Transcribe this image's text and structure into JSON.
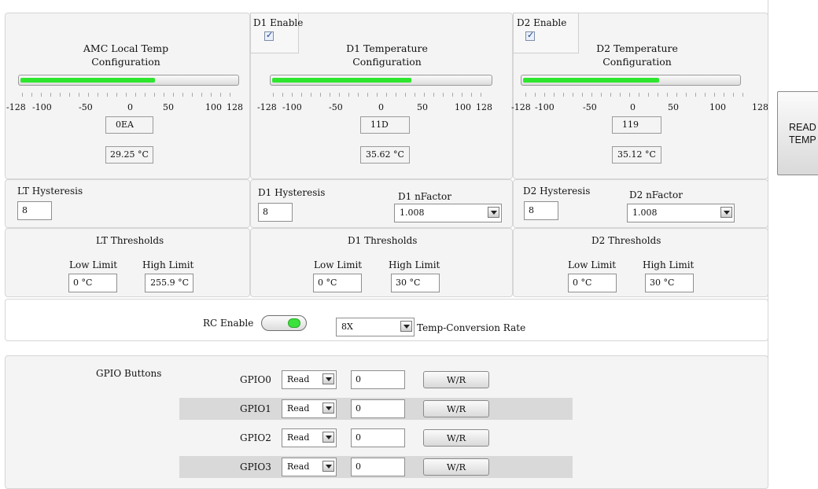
{
  "amc": {
    "title_line1": "AMC Local Temp",
    "title_line2": "Configuration",
    "hex": "0EA",
    "temp": "29.25 °C",
    "level": 0.62
  },
  "d1": {
    "enable_label": "D1 Enable",
    "enabled": true,
    "title_line1": "D1 Temperature",
    "title_line2": "Configuration",
    "hex": "11D",
    "temp": "35.62 °C",
    "level": 0.64,
    "hysteresis_label": "D1 Hysteresis",
    "hysteresis": "8",
    "nfactor_label": "D1 nFactor",
    "nfactor": "1.008",
    "thresholds_label": "D1 Thresholds",
    "low_label": "Low Limit",
    "high_label": "High Limit",
    "low": "0 °C",
    "high": "30 °C"
  },
  "d2": {
    "enable_label": "D2 Enable",
    "enabled": true,
    "title_line1": "D2 Temperature",
    "title_line2": "Configuration",
    "hex": "119",
    "temp": "35.12 °C",
    "level": 0.63,
    "hysteresis_label": "D2 Hysteresis",
    "hysteresis": "8",
    "nfactor_label": "D2 nFactor",
    "nfactor": "1.008",
    "thresholds_label": "D2 Thresholds",
    "low_label": "Low Limit",
    "high_label": "High Limit",
    "low": "0 °C",
    "high": "30 °C"
  },
  "lt": {
    "hysteresis_label": "LT Hysteresis",
    "hysteresis": "8",
    "thresholds_label": "LT Thresholds",
    "low_label": "Low Limit",
    "high_label": "High Limit",
    "low": "0 °C",
    "high": "255.9 °C"
  },
  "scale_labels": [
    "-128",
    "-100",
    "-50",
    "0",
    "50",
    "100",
    "128"
  ],
  "read_temp": {
    "line1": "READ",
    "line2": "TEMP"
  },
  "rc": {
    "enable_label": "RC Enable",
    "rate": "8X",
    "rate_label": "Temp-Conversion Rate"
  },
  "gpio": {
    "section_label": "GPIO Buttons",
    "rows": [
      {
        "name": "GPIO0",
        "mode": "Read",
        "value": "0",
        "button": "W/R"
      },
      {
        "name": "GPIO1",
        "mode": "Read",
        "value": "0",
        "button": "W/R"
      },
      {
        "name": "GPIO2",
        "mode": "Read",
        "value": "0",
        "button": "W/R"
      },
      {
        "name": "GPIO3",
        "mode": "Read",
        "value": "0",
        "button": "W/R"
      }
    ]
  },
  "colors": {
    "level_fill": "#2ee62e",
    "panel_bg": "#f4f4f4",
    "row_shade": "#d9d9d9"
  }
}
